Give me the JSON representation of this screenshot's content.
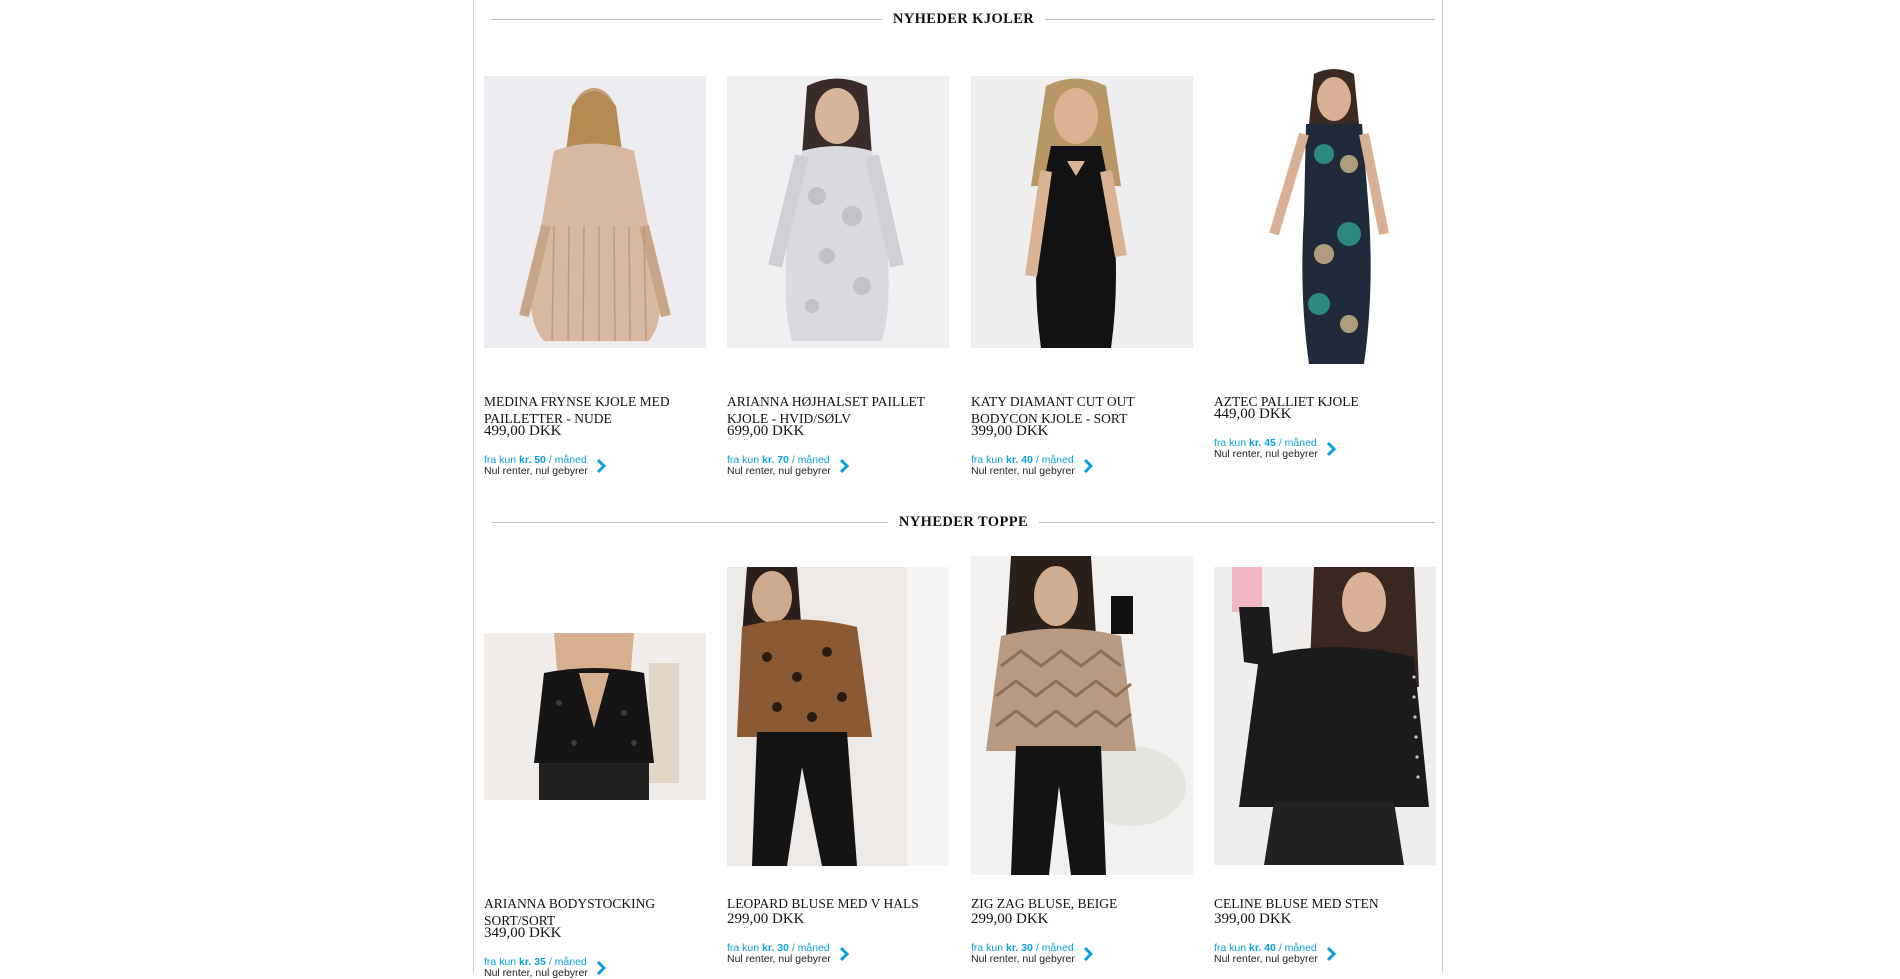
{
  "sections": [
    {
      "title": "NYHEDER KJOLER",
      "products": [
        {
          "name": "MEDINA FRYNSE KJOLE MED PAILLETTER - NUDE",
          "price": "499,00 DKK",
          "fin_prefix": "fra kun",
          "fin_amount": "kr. 50",
          "fin_suffix": "/ måned",
          "fin_note": "Nul renter, nul gebyrer",
          "image": "dress-nude-fringe"
        },
        {
          "name": "ARIANNA HØJHALSET PAILLET KJOLE - HVID/SØLV",
          "price": "699,00 DKK",
          "fin_prefix": "fra kun",
          "fin_amount": "kr. 70",
          "fin_suffix": "/ måned",
          "fin_note": "Nul renter, nul gebyrer",
          "image": "dress-silver-sequin"
        },
        {
          "name": "KATY DIAMANT CUT OUT BODYCON KJOLE - SORT",
          "price": "399,00 DKK",
          "fin_prefix": "fra kun",
          "fin_amount": "kr. 40",
          "fin_suffix": "/ måned",
          "fin_note": "Nul renter, nul gebyrer",
          "image": "dress-black-bodycon"
        },
        {
          "name": "AZTEC PALLIET KJOLE",
          "price": "449,00 DKK",
          "fin_prefix": "fra kun",
          "fin_amount": "kr. 45",
          "fin_suffix": "/ måned",
          "fin_note": "Nul renter, nul gebyrer",
          "image": "dress-aztec-sequin"
        }
      ]
    },
    {
      "title": "NYHEDER TOPPE",
      "products": [
        {
          "name": "ARIANNA BODYSTOCKING SORT/SORT",
          "price": "349,00 DKK",
          "fin_prefix": "fra kun",
          "fin_amount": "kr. 35",
          "fin_suffix": "/ måned",
          "fin_note": "Nul renter, nul gebyrer",
          "image": "bodystocking-black"
        },
        {
          "name": "LEOPARD BLUSE MED V HALS",
          "price": "299,00 DKK",
          "fin_prefix": "fra kun",
          "fin_amount": "kr. 30",
          "fin_suffix": "/ måned",
          "fin_note": "Nul renter, nul gebyrer",
          "image": "blouse-leopard"
        },
        {
          "name": "ZIG ZAG BLUSE, BEIGE",
          "price": "299,00 DKK",
          "fin_prefix": "fra kun",
          "fin_amount": "kr. 30",
          "fin_suffix": "/ måned",
          "fin_note": "Nul renter, nul gebyrer",
          "image": "blouse-zigzag-beige"
        },
        {
          "name": "CELINE BLUSE MED STEN",
          "price": "399,00 DKK",
          "fin_prefix": "fra kun",
          "fin_amount": "kr. 40",
          "fin_suffix": "/ måned",
          "fin_note": "Nul renter, nul gebyrer",
          "image": "blouse-black-stones"
        }
      ]
    }
  ],
  "colors": {
    "accent": "#0aa0db",
    "text": "#111111",
    "divider": "#bdbdbd"
  }
}
